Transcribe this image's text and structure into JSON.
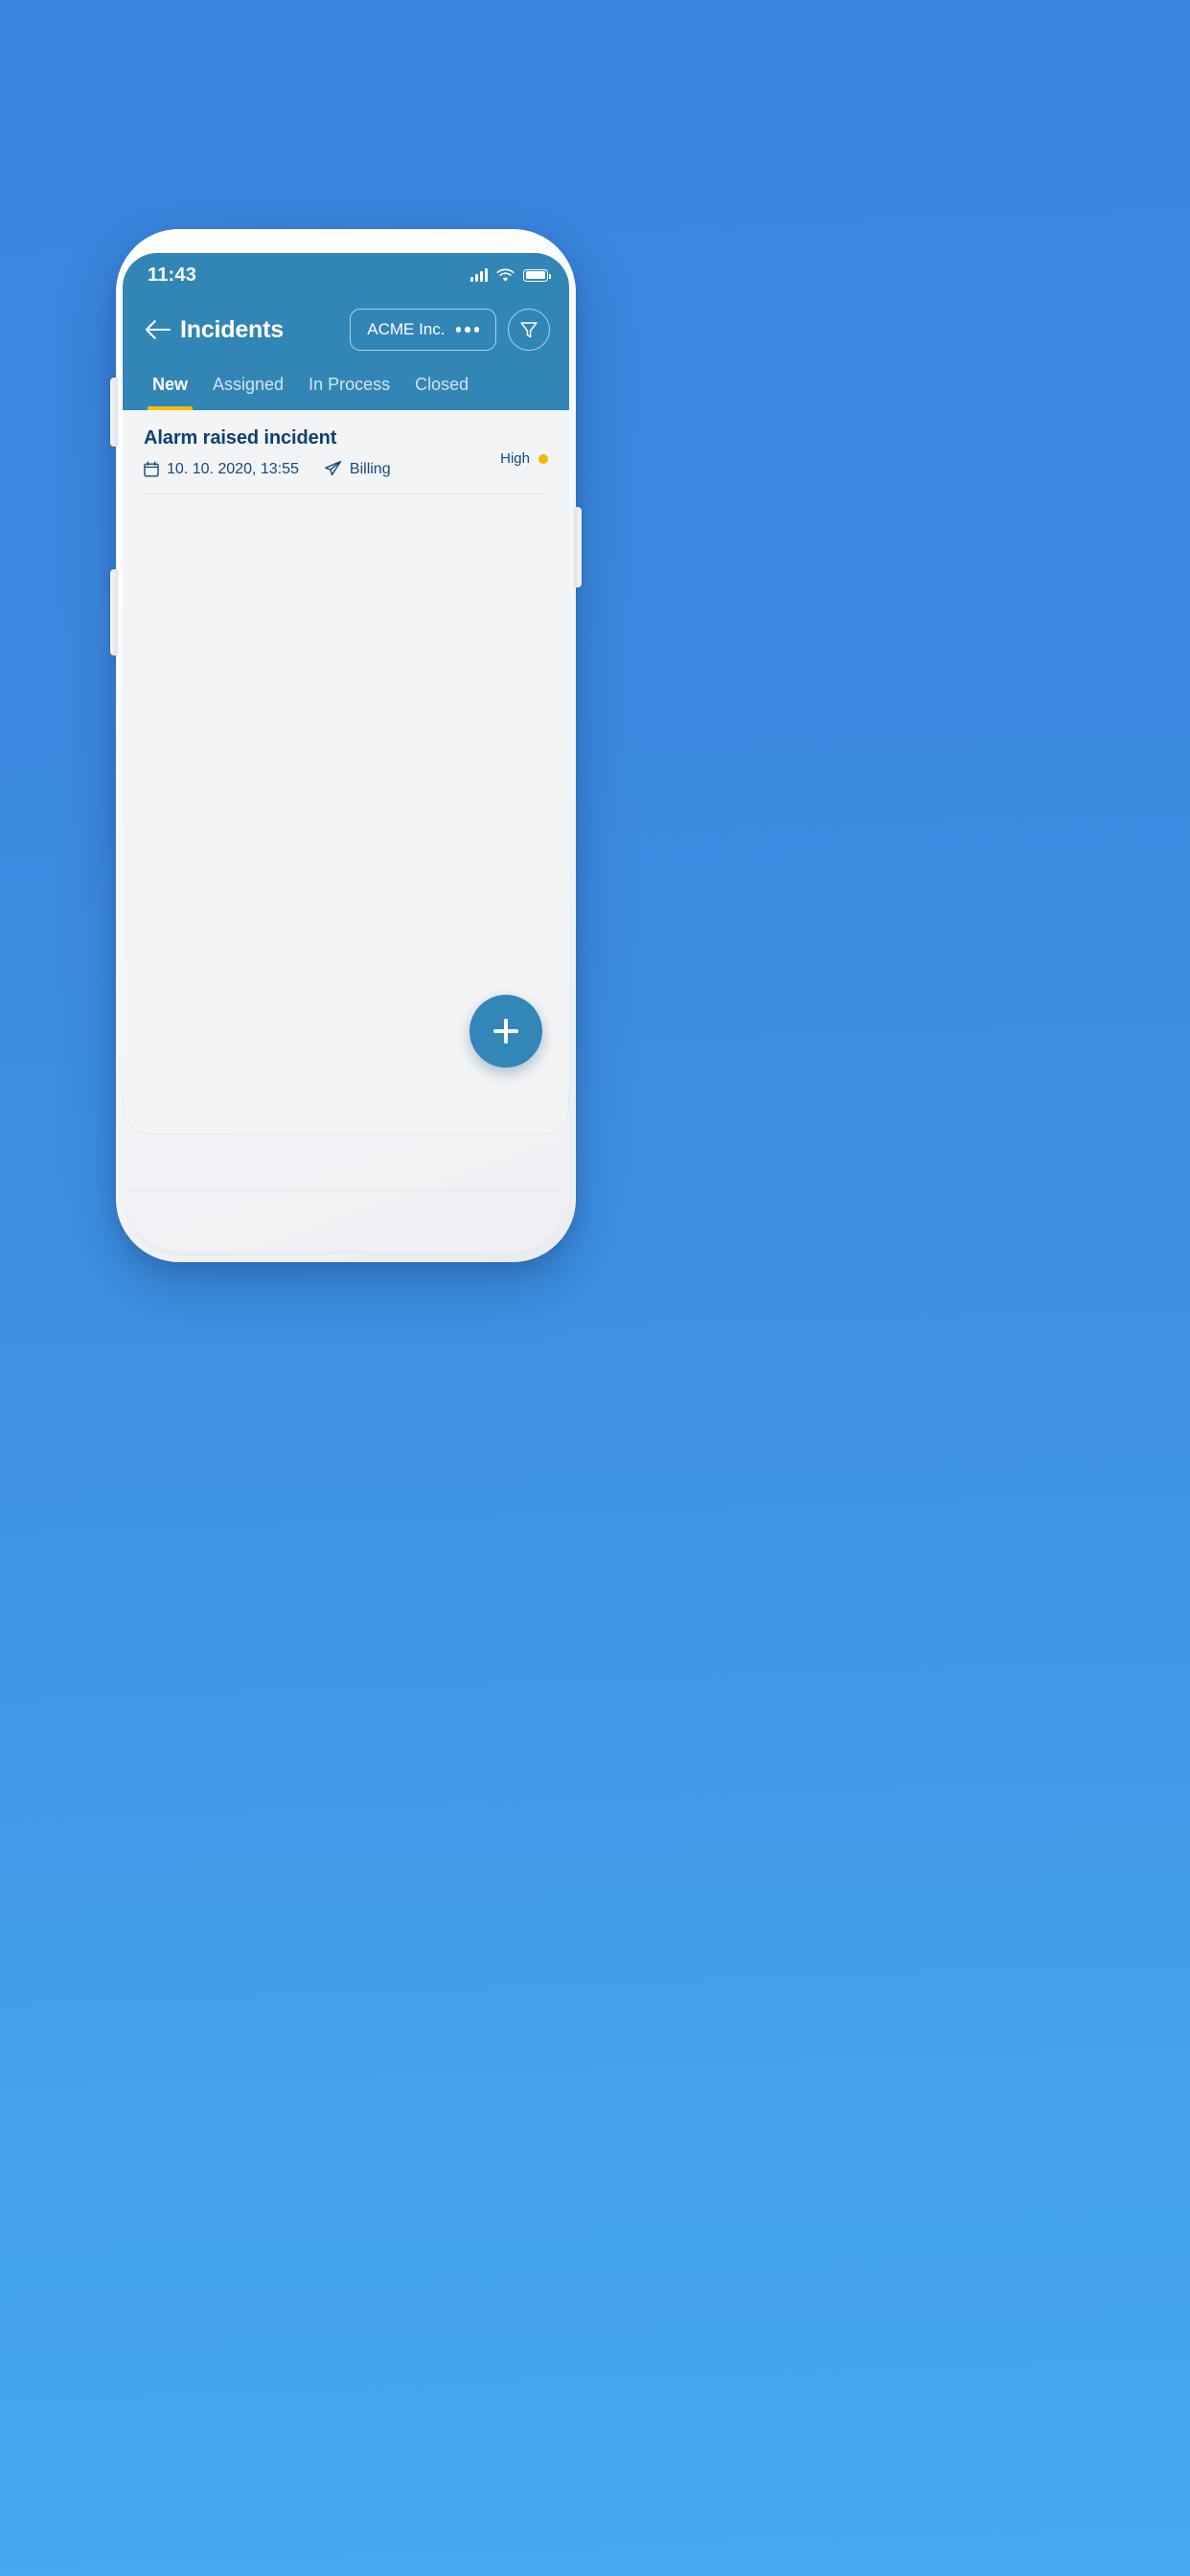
{
  "theme": {
    "page_background_blue": "#3a84de",
    "header_blue": "#3286b6",
    "accent_yellow": "#f2c200",
    "priority_dot_yellow": "#f2b705",
    "text_navy": "#103f73",
    "screen_background": "#f3f4f5",
    "fab_blue": "#3287b8"
  },
  "status_bar": {
    "time": "11:43",
    "signal_icon": "signal-bars-icon",
    "wifi_icon": "wifi-icon",
    "battery_icon": "battery-full-icon"
  },
  "app_bar": {
    "back_icon": "arrow-left-icon",
    "title": "Incidents",
    "account_pill": {
      "label": "ACME Inc.",
      "overflow_icon": "more-horizontal-icon"
    },
    "filter_icon": "funnel-filter-icon"
  },
  "tabs": {
    "active_index": 0,
    "items": [
      {
        "label": "New"
      },
      {
        "label": "Assigned"
      },
      {
        "label": "In Process"
      },
      {
        "label": "Closed"
      }
    ]
  },
  "incident_list": {
    "items": [
      {
        "title": "Alarm raised incident",
        "date_icon": "calendar-icon",
        "date": "10. 10. 2020, 13:55",
        "category_icon": "send-paper-plane-icon",
        "category": "Billing",
        "priority": "High"
      }
    ]
  },
  "fab": {
    "icon": "plus-icon",
    "label": "+"
  },
  "device": {
    "speaker_grille": "speaker-grille",
    "volume_up_button": "volume-up-button",
    "volume_down_button": "volume-down-button",
    "power_button": "power-button",
    "charging_port": "charging-port"
  }
}
